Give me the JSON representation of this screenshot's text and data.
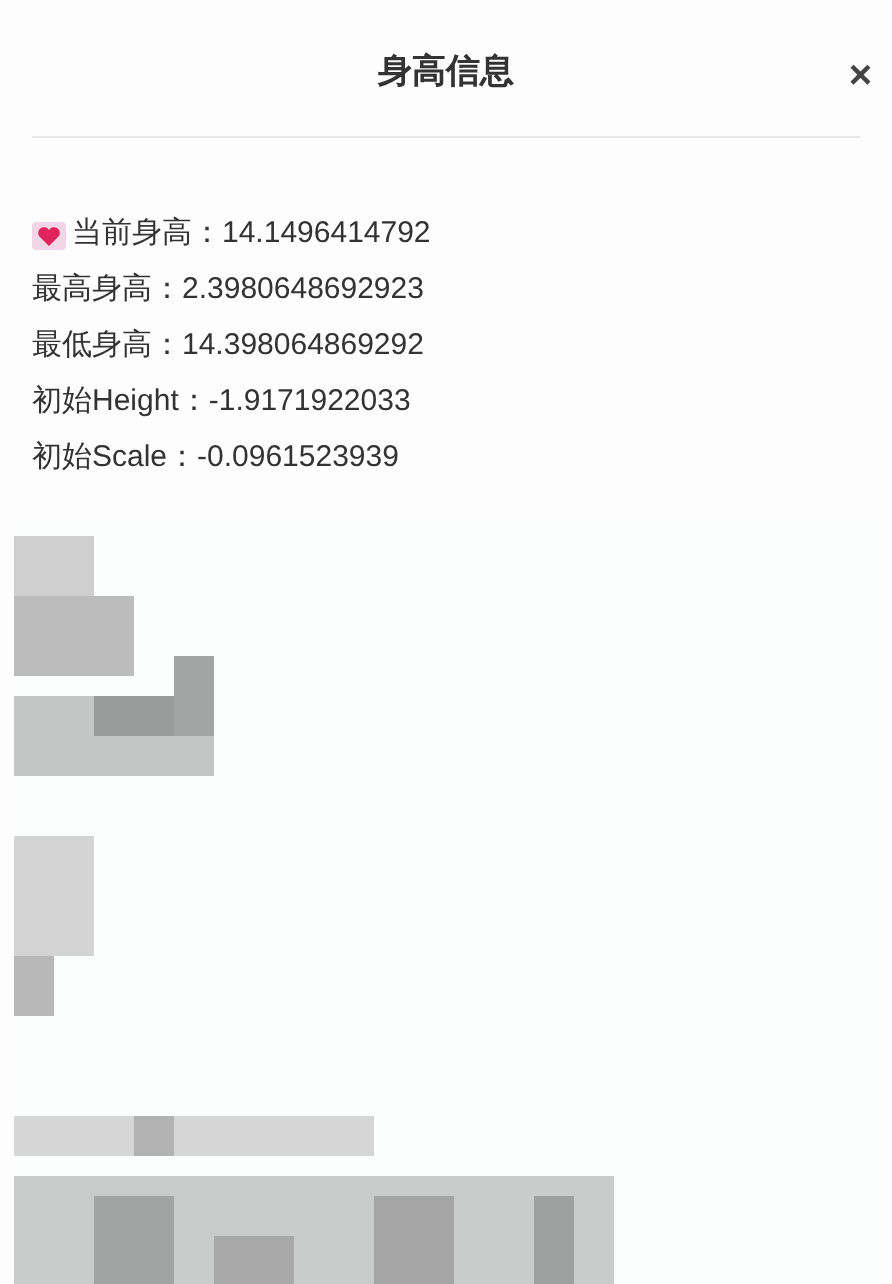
{
  "dialog": {
    "title": "身高信息",
    "close": "×"
  },
  "lines": [
    {
      "kind": "heart",
      "text": "当前身高：14.1496414792"
    },
    {
      "kind": "plain",
      "text": "最高身高：2.3980648692923"
    },
    {
      "kind": "plain",
      "text": "最低身高：14.398064869292"
    },
    {
      "kind": "plain",
      "text": "初始Height：-1.9171922033"
    },
    {
      "kind": "plain",
      "text": "初始Scale：-0.0961523939"
    }
  ]
}
